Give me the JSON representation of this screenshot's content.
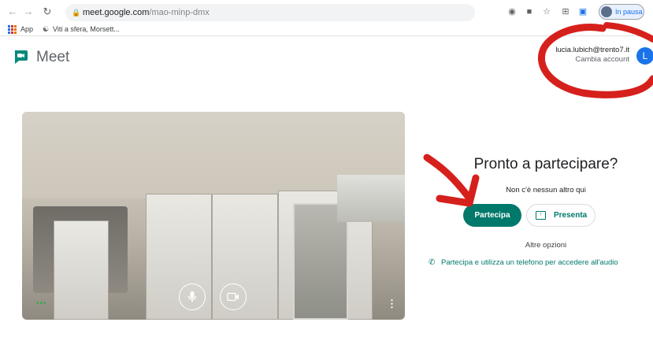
{
  "browser": {
    "url_host": "meet.google.com",
    "url_path": "/mao-minp-dmx",
    "profile_status": "In pausa",
    "bookmarks": [
      {
        "label": "App"
      },
      {
        "label": "Viti a sfera, Morsett..."
      }
    ]
  },
  "header": {
    "app_name": "Meet",
    "account_email": "lucia.lubich@trento7.it",
    "switch_account": "Cambia account",
    "avatar_letter": "L"
  },
  "preview": {
    "mic_icon": "mic-icon",
    "camera_icon": "camera-icon"
  },
  "join_panel": {
    "title": "Pronto a partecipare?",
    "status": "Non c'è nessun altro qui",
    "join_label": "Partecipa",
    "present_label": "Presenta",
    "more_options": "Altre opzioni",
    "phone_option": "Partecipa e utilizza un telefono per accedere all'audio"
  },
  "annotation_color": "#d6201c",
  "brand_color": "#00796b"
}
